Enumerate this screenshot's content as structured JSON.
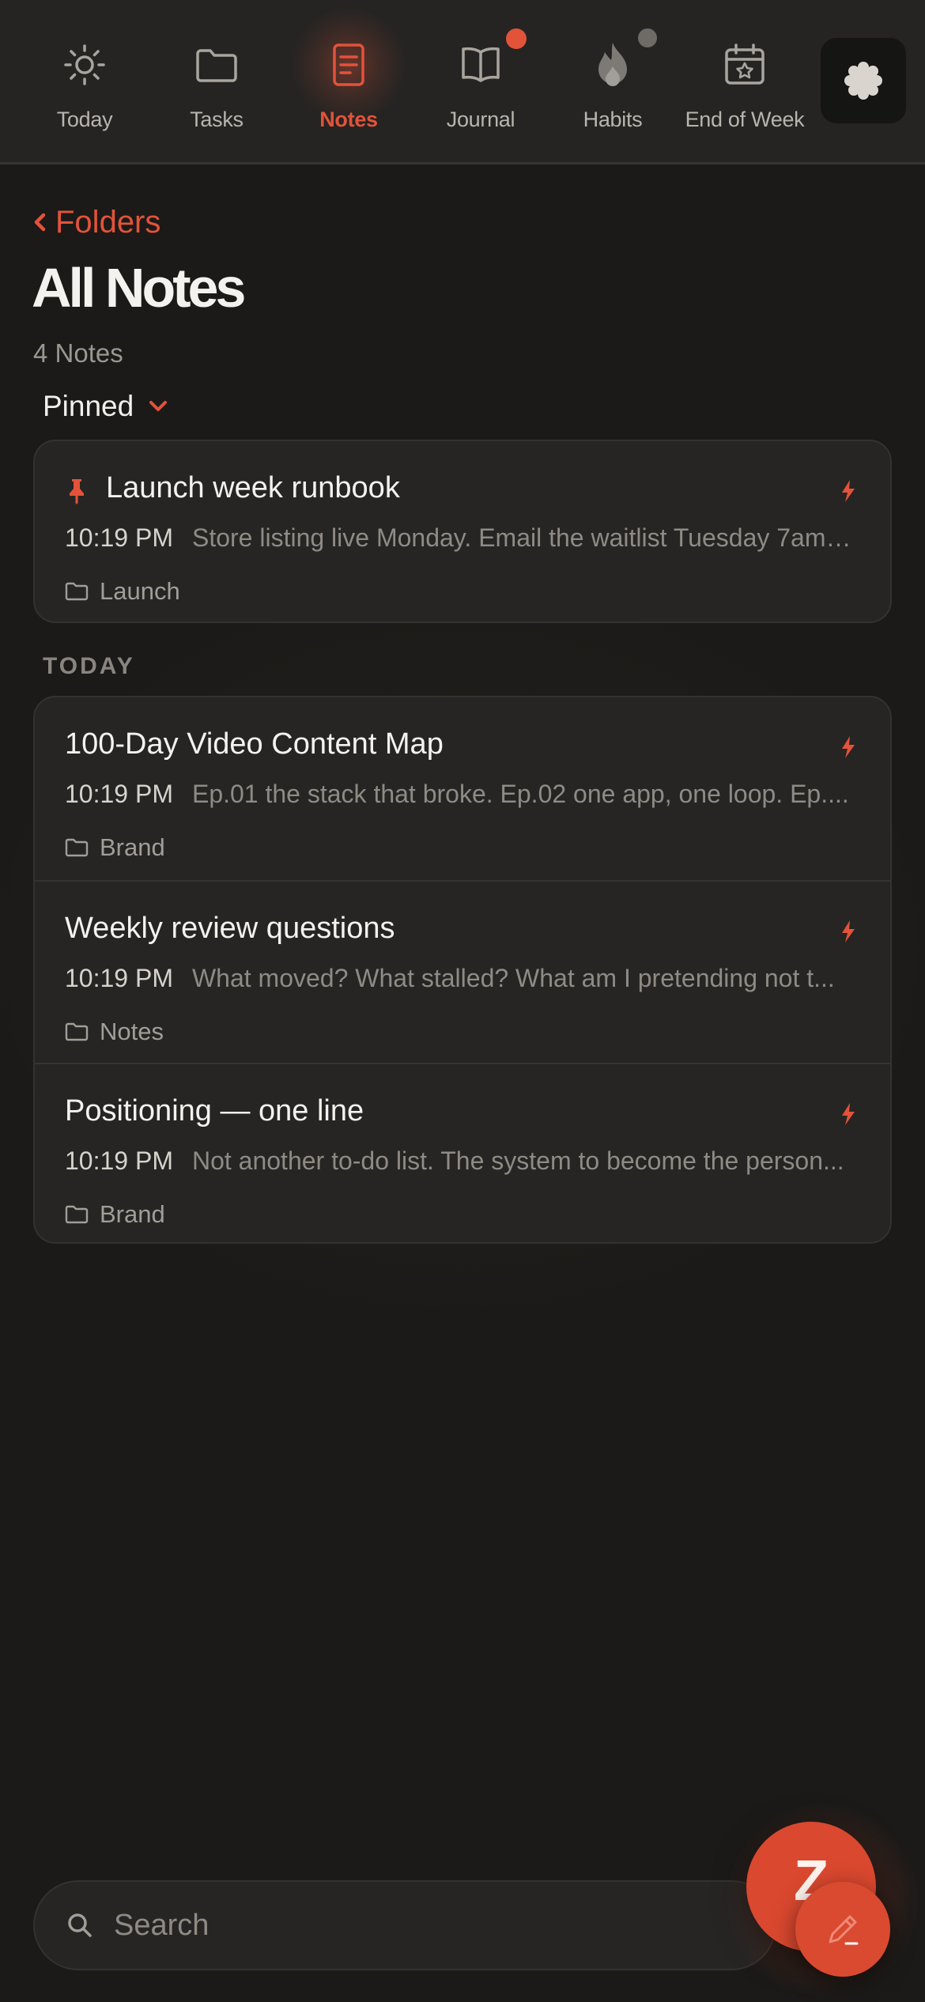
{
  "colors": {
    "accent": "#e2533a",
    "background": "#1b1a18",
    "card": "#262523",
    "muted_text": "#8f8b84"
  },
  "tabbar": {
    "tabs": [
      {
        "label": "Today",
        "icon": "sun-icon",
        "active": false
      },
      {
        "label": "Tasks",
        "icon": "folder-icon",
        "active": false
      },
      {
        "label": "Notes",
        "icon": "note-icon",
        "active": true
      },
      {
        "label": "Journal",
        "icon": "book-icon",
        "active": false,
        "badge": "red-dot"
      },
      {
        "label": "Habits",
        "icon": "flame-icon",
        "active": false,
        "badge": "grey-dot"
      },
      {
        "label": "End of Week",
        "icon": "calendar-star-icon",
        "active": false
      }
    ],
    "settings_icon": "gear-icon"
  },
  "header": {
    "back_label": "Folders",
    "title": "All Notes",
    "count": "4 Notes",
    "pinned_label": "Pinned"
  },
  "pinned_notes": [
    {
      "title": "Launch week runbook",
      "time": "10:19 PM",
      "preview": "Store listing live Monday. Email the waitlist Tuesday 7am. ...",
      "folder": "Launch"
    }
  ],
  "sections": {
    "today_label": "TODAY"
  },
  "today_notes": [
    {
      "title": "100-Day Video Content Map",
      "time": "10:19 PM",
      "preview": "Ep.01 the stack that broke. Ep.02 one app, one loop. Ep....",
      "folder": "Brand"
    },
    {
      "title": "Weekly review questions",
      "time": "10:19 PM",
      "preview": "What moved? What stalled? What am I pretending not t...",
      "folder": "Notes"
    },
    {
      "title": "Positioning — one line",
      "time": "10:19 PM",
      "preview": "Not another to-do list. The system to become the person...",
      "folder": "Brand"
    }
  ],
  "search": {
    "placeholder": "Search"
  },
  "fab": {
    "brand_letter": "Z",
    "compose_icon": "pencil-icon"
  }
}
